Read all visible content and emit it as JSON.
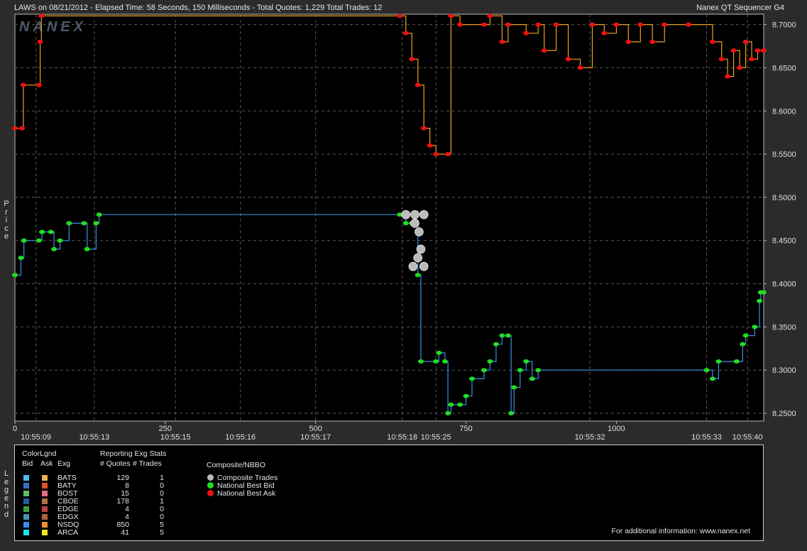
{
  "header": {
    "left": "LAWS on 08/21/2012  -  Elapsed Time: 58 Seconds, 150 Milliseconds  -  Total Quotes: 1,229  Total Trades: 12",
    "right": "Nanex QT Sequencer G4",
    "watermark": "NANEX"
  },
  "side_labels": {
    "price": "Price",
    "legend": "Legend"
  },
  "chart_data": {
    "type": "line",
    "y_ticks": [
      "8.7000",
      "8.6500",
      "8.6000",
      "8.5500",
      "8.5000",
      "8.4500",
      "8.4000",
      "8.3500",
      "8.3000",
      "8.2500"
    ],
    "y_tick_values": [
      8.7,
      8.65,
      8.6,
      8.55,
      8.5,
      8.45,
      8.4,
      8.35,
      8.3,
      8.25
    ],
    "ylim": [
      8.241,
      8.712
    ],
    "xlim": [
      0,
      1245
    ],
    "x_ticks": [
      {
        "value": 0,
        "label": "0"
      },
      {
        "value": 250,
        "label": "250"
      },
      {
        "value": 500,
        "label": "500"
      },
      {
        "value": 750,
        "label": "750"
      },
      {
        "value": 1000,
        "label": "1000"
      }
    ],
    "time_ticks": [
      {
        "value": 35,
        "label": "10:55:09"
      },
      {
        "value": 132,
        "label": "10:55:13"
      },
      {
        "value": 267,
        "label": "10:55:15"
      },
      {
        "value": 375,
        "label": "10:55:16"
      },
      {
        "value": 500,
        "label": "10:55:17"
      },
      {
        "value": 644,
        "label": "10:55:18"
      },
      {
        "value": 700,
        "label": "10:55:25"
      },
      {
        "value": 956,
        "label": "10:55:32"
      },
      {
        "value": 1150,
        "label": "10:55:33"
      },
      {
        "value": 1218,
        "label": "10:55:40"
      }
    ],
    "grid": true,
    "colors": {
      "bid_line": "#3a8fe8",
      "ask_line": "#f0a020",
      "bid_marker": "#22dd22",
      "ask_marker": "#ee1111",
      "trade_marker": "#bbbbbb",
      "background": "#000000",
      "grid": "#5a5a5a"
    },
    "series": [
      {
        "name": "National Best Ask",
        "points": [
          [
            0,
            8.58
          ],
          [
            12,
            8.58
          ],
          [
            14,
            8.63
          ],
          [
            40,
            8.63
          ],
          [
            42,
            8.68
          ],
          [
            44,
            8.71
          ],
          [
            640,
            8.71
          ],
          [
            650,
            8.69
          ],
          [
            660,
            8.66
          ],
          [
            670,
            8.63
          ],
          [
            680,
            8.58
          ],
          [
            690,
            8.56
          ],
          [
            700,
            8.55
          ],
          [
            720,
            8.55
          ],
          [
            725,
            8.71
          ],
          [
            740,
            8.7
          ],
          [
            780,
            8.7
          ],
          [
            790,
            8.71
          ],
          [
            810,
            8.68
          ],
          [
            820,
            8.7
          ],
          [
            850,
            8.69
          ],
          [
            870,
            8.7
          ],
          [
            880,
            8.67
          ],
          [
            900,
            8.7
          ],
          [
            920,
            8.66
          ],
          [
            940,
            8.65
          ],
          [
            960,
            8.7
          ],
          [
            980,
            8.69
          ],
          [
            1000,
            8.7
          ],
          [
            1020,
            8.68
          ],
          [
            1040,
            8.7
          ],
          [
            1060,
            8.68
          ],
          [
            1080,
            8.7
          ],
          [
            1120,
            8.7
          ],
          [
            1160,
            8.68
          ],
          [
            1175,
            8.66
          ],
          [
            1185,
            8.64
          ],
          [
            1195,
            8.67
          ],
          [
            1205,
            8.65
          ],
          [
            1215,
            8.68
          ],
          [
            1225,
            8.66
          ],
          [
            1235,
            8.67
          ],
          [
            1245,
            8.67
          ]
        ]
      },
      {
        "name": "National Best Bid",
        "points": [
          [
            0,
            8.41
          ],
          [
            10,
            8.43
          ],
          [
            15,
            8.45
          ],
          [
            40,
            8.45
          ],
          [
            45,
            8.46
          ],
          [
            60,
            8.46
          ],
          [
            65,
            8.44
          ],
          [
            75,
            8.45
          ],
          [
            90,
            8.47
          ],
          [
            115,
            8.47
          ],
          [
            120,
            8.44
          ],
          [
            135,
            8.47
          ],
          [
            140,
            8.48
          ],
          [
            640,
            8.48
          ],
          [
            650,
            8.47
          ],
          [
            660,
            8.47
          ],
          [
            670,
            8.41
          ],
          [
            675,
            8.31
          ],
          [
            700,
            8.31
          ],
          [
            705,
            8.32
          ],
          [
            715,
            8.31
          ],
          [
            720,
            8.25
          ],
          [
            725,
            8.26
          ],
          [
            740,
            8.26
          ],
          [
            750,
            8.27
          ],
          [
            760,
            8.29
          ],
          [
            780,
            8.3
          ],
          [
            790,
            8.31
          ],
          [
            800,
            8.33
          ],
          [
            810,
            8.34
          ],
          [
            820,
            8.34
          ],
          [
            825,
            8.25
          ],
          [
            830,
            8.28
          ],
          [
            840,
            8.3
          ],
          [
            850,
            8.31
          ],
          [
            860,
            8.29
          ],
          [
            870,
            8.3
          ],
          [
            1150,
            8.3
          ],
          [
            1160,
            8.29
          ],
          [
            1170,
            8.31
          ],
          [
            1200,
            8.31
          ],
          [
            1210,
            8.33
          ],
          [
            1215,
            8.34
          ],
          [
            1230,
            8.35
          ],
          [
            1238,
            8.38
          ],
          [
            1240,
            8.39
          ],
          [
            1245,
            8.39
          ]
        ]
      },
      {
        "name": "Composite Trades",
        "points": [
          [
            650,
            8.48
          ],
          [
            665,
            8.48
          ],
          [
            680,
            8.48
          ],
          [
            665,
            8.47
          ],
          [
            672,
            8.46
          ],
          [
            670,
            8.43
          ],
          [
            662,
            8.42
          ],
          [
            680,
            8.42
          ],
          [
            675,
            8.44
          ]
        ]
      }
    ]
  },
  "legend": {
    "title": "ColorLgnd",
    "col_bid": "Bid",
    "col_ask": "Ask",
    "col_exg": "Exg",
    "stats_title": "Reporting Exg Stats",
    "col_quotes": "# Quotes",
    "col_trades": "# Trades",
    "rows": [
      {
        "exg": "BATS",
        "quotes": "129",
        "trades": "1",
        "bid_color": "#4fb8f0",
        "ask_color": "#f0b050"
      },
      {
        "exg": "BATY",
        "quotes": "8",
        "trades": "0",
        "bid_color": "#3a70c8",
        "ask_color": "#e05020"
      },
      {
        "exg": "BOST",
        "quotes": "15",
        "trades": "0",
        "bid_color": "#60c060",
        "ask_color": "#e07080"
      },
      {
        "exg": "CBOE",
        "quotes": "178",
        "trades": "1",
        "bid_color": "#2858a8",
        "ask_color": "#b07040"
      },
      {
        "exg": "EDGE",
        "quotes": "4",
        "trades": "0",
        "bid_color": "#40a040",
        "ask_color": "#c04040"
      },
      {
        "exg": "EDGX",
        "quotes": "4",
        "trades": "0",
        "bid_color": "#4a90b0",
        "ask_color": "#b06040"
      },
      {
        "exg": "NSDQ",
        "quotes": "850",
        "trades": "5",
        "bid_color": "#3a8fe8",
        "ask_color": "#f09030"
      },
      {
        "exg": "ARCA",
        "quotes": "41",
        "trades": "5",
        "bid_color": "#20e0f0",
        "ask_color": "#f0e020"
      }
    ],
    "composite_title": "Composite/NBBO",
    "composite_items": [
      {
        "label": "Composite Trades",
        "color": "#bbbbbb"
      },
      {
        "label": "National Best Bid",
        "color": "#22dd22"
      },
      {
        "label": "National Best Ask",
        "color": "#ee1111"
      }
    ],
    "footer": "For additional information: www.nanex.net"
  }
}
